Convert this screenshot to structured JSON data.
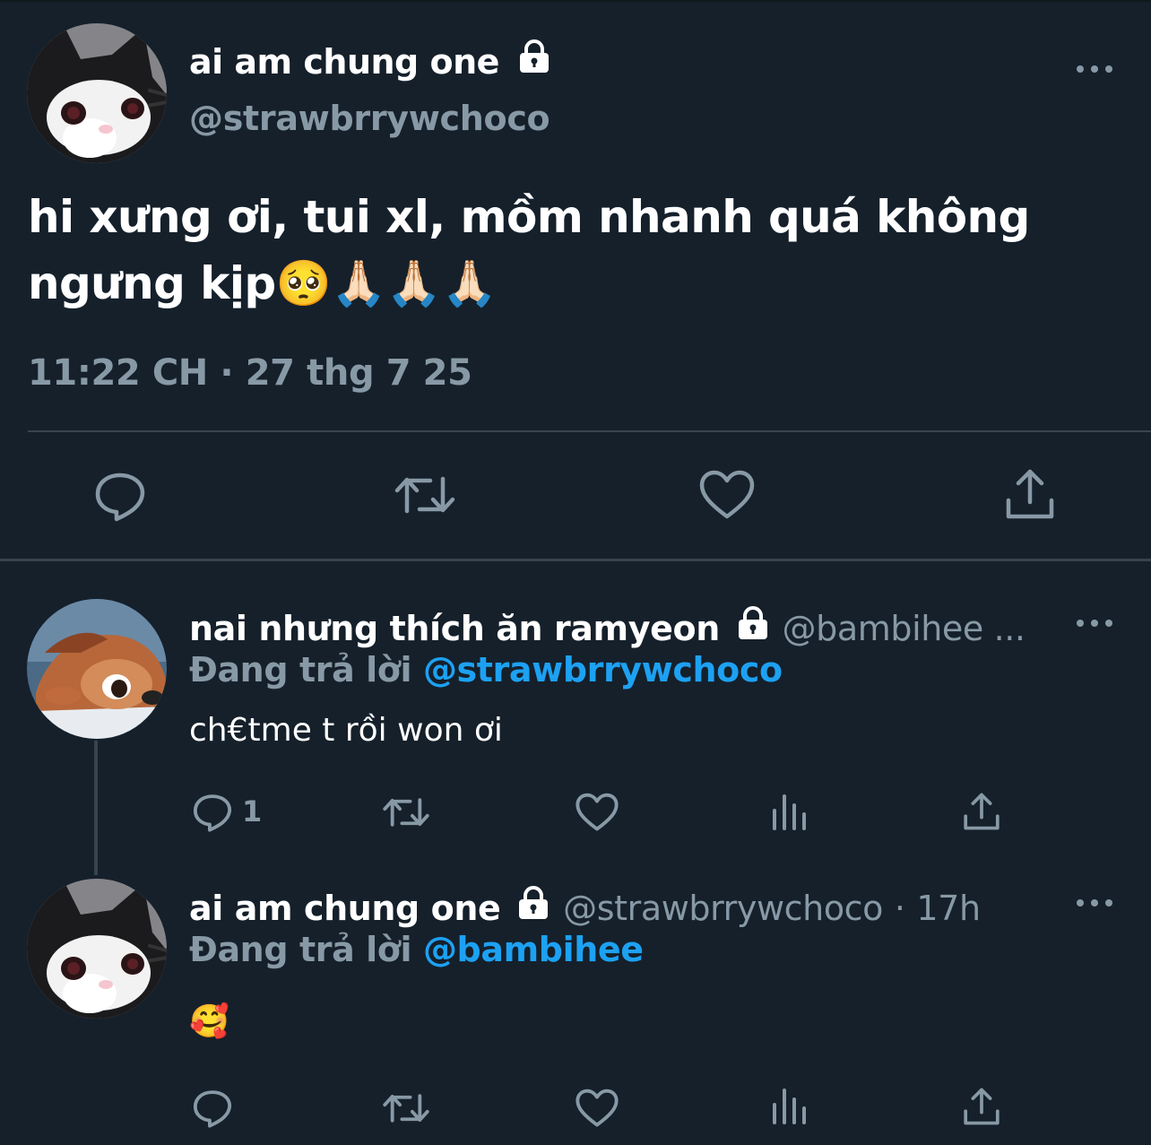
{
  "main_tweet": {
    "name": "ai am chung one",
    "handle": "@strawbrrywchoco",
    "text_line1": "hi xưng ơi, tui xl, mồm nhanh quá không",
    "text_line2": "ngưng kịp",
    "text_emojis": "🥺🙏🏻🙏🏻🙏🏻",
    "time": "11:22 CH",
    "separator": "·",
    "date": "27 thg 7 25",
    "icons": [
      "reply-icon",
      "retweet-icon",
      "like-icon",
      "share-icon"
    ]
  },
  "replies": [
    {
      "name": "nai nhưng thích ăn ramyeon",
      "handle": "@bambihee ...",
      "replying_label": "Đang trả lời",
      "replying_to": "@strawbrrywchoco",
      "text": "ch€tme t rồi won ơi",
      "reply_count": "1"
    },
    {
      "name": "ai am chung one",
      "handle": "@strawbrrywchoco",
      "time_sep": "·",
      "time": "17h",
      "replying_label": "Đang trả lời",
      "replying_to": "@bambihee",
      "text": "🥰"
    }
  ],
  "colors": {
    "background": "#15202b",
    "text_primary": "#ffffff",
    "text_secondary": "#8899a6",
    "link": "#1da1f2",
    "divider": "#38444d"
  }
}
